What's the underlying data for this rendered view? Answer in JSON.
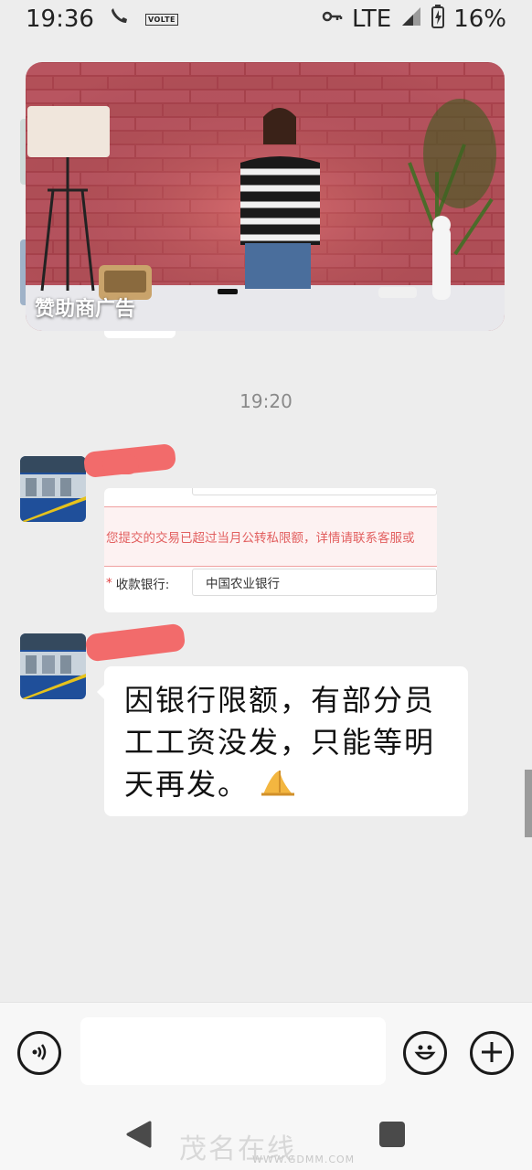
{
  "status_bar": {
    "time": "19:36",
    "volte": "VOLTE",
    "network": "LTE",
    "battery": "16%"
  },
  "ad": {
    "label": "赞助商广告"
  },
  "chat": {
    "timestamp": "19:20",
    "image_message": {
      "error_text": "您提交的交易已超过当月公转私限额，详情请联系客服或",
      "field_label": "收款银行:",
      "field_value": "中国农业银行"
    },
    "text_message": {
      "line1": "因银行限额，有部分员",
      "line2": "工工资没发，只能等明",
      "line3": "天再发。",
      "emoji": "pray-hands-emoji"
    }
  },
  "input_bar": {
    "placeholder": "",
    "voice_icon": "voice-icon",
    "emoji_icon": "smiley-icon",
    "add_icon": "plus-icon"
  },
  "nav": {
    "watermark": "茂名在线",
    "watermark_url": "WWW.GDMM.COM"
  },
  "colors": {
    "background": "#ededed",
    "bubble": "#ffffff",
    "redaction": "#f26b6b",
    "error_text": "#e26060"
  }
}
